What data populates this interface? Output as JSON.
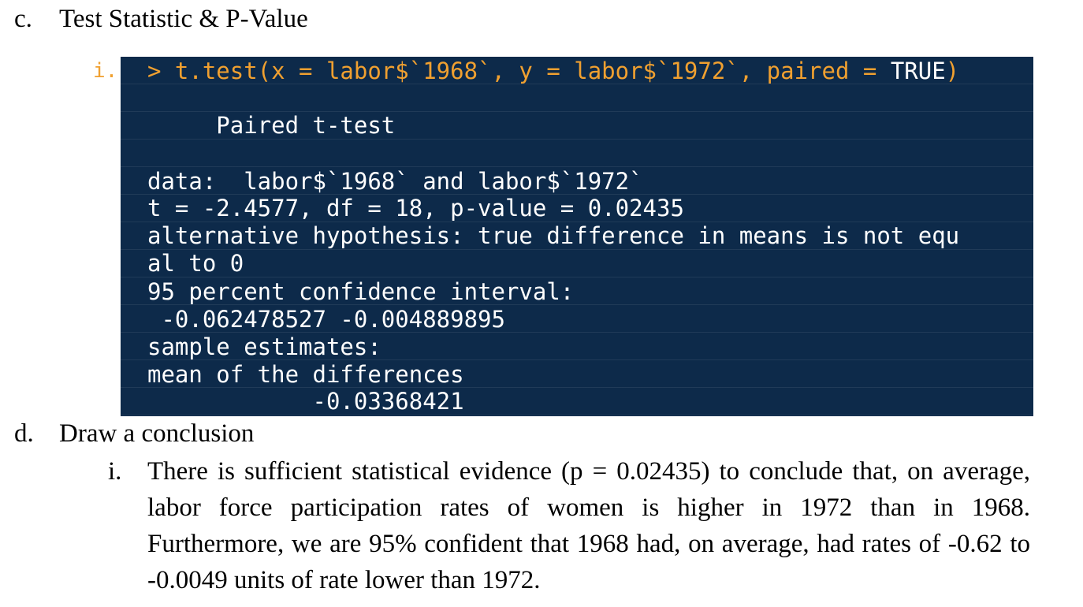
{
  "section_c": {
    "marker": "c.",
    "title": "Test Statistic & P-Value"
  },
  "console": {
    "item_marker": "i.",
    "command_prefix": "> t.test(x = labor$`1968`, y = labor$`1972`, paired = ",
    "command_keyword": "TRUE",
    "command_suffix": ")",
    "lines": [
      "     Paired t-test",
      "",
      "data:  labor$`1968` and labor$`1972`",
      "t = -2.4577, df = 18, p-value = 0.02435",
      "alternative hypothesis: true difference in means is not equ",
      "al to 0",
      "95 percent confidence interval:",
      " -0.062478527 -0.004889895",
      "sample estimates:",
      "mean of the differences",
      "            -0.03368421"
    ]
  },
  "section_d": {
    "marker": "d.",
    "title": "Draw a conclusion",
    "item_marker": "i.",
    "conclusion": "There is sufficient statistical evidence (p = 0.02435) to conclude that, on average, labor force participation rates of women is higher in 1972 than in 1968. Furthermore, we are 95% confident that 1968 had, on average, had rates of -0.62 to -0.0049 units of rate lower than 1972."
  }
}
